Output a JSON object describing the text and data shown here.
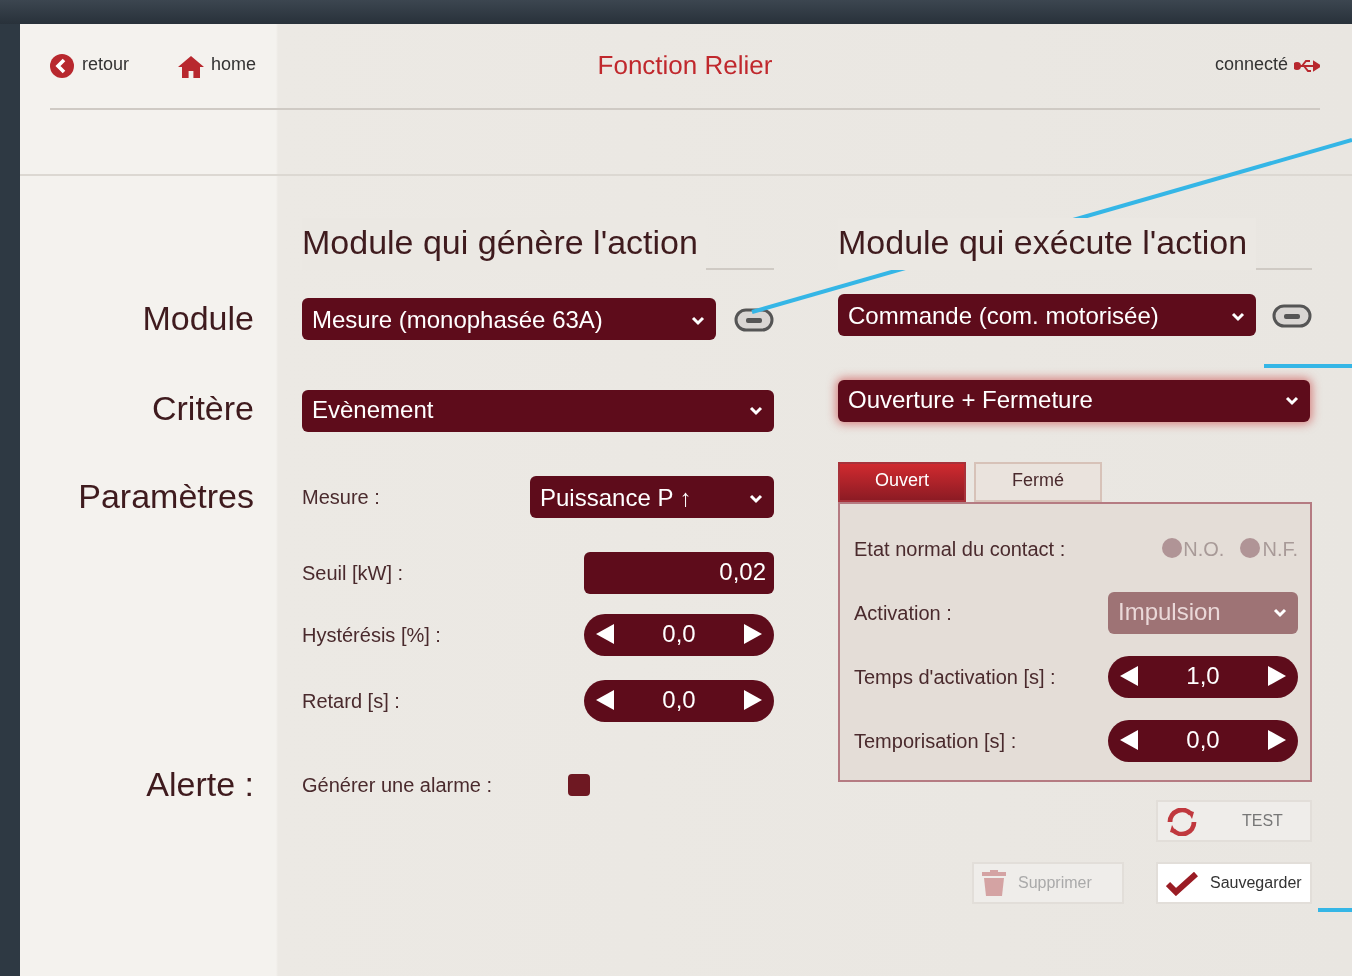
{
  "header": {
    "back": "retour",
    "home": "home",
    "title": "Fonction Relier",
    "status": "connecté"
  },
  "row_labels": [
    "Module",
    "Critère",
    "Paramètres",
    "Alerte :"
  ],
  "generator": {
    "heading": "Module qui génère l'action",
    "module": "Mesure (monophasée 63A)",
    "criterion": "Evènement",
    "params": [
      {
        "kind": "select",
        "label": "Mesure :",
        "value": "Puissance P ↑"
      },
      {
        "kind": "input",
        "label": "Seuil [kW]  :",
        "value": "0,02"
      },
      {
        "kind": "stepper",
        "label": "Hystérésis [%] :",
        "value": "0,0"
      },
      {
        "kind": "stepper",
        "label": "Retard [s] :",
        "value": "0,0"
      }
    ],
    "alert": {
      "label": "Générer une alarme :",
      "checked": true
    }
  },
  "executor": {
    "heading": "Module qui exécute l'action",
    "module": "Commande (com. motorisée)",
    "action": "Ouverture + Fermeture",
    "tabs": [
      {
        "label": "Ouvert",
        "selected": true
      },
      {
        "label": "Fermé",
        "selected": false
      }
    ],
    "fields": [
      {
        "kind": "radio",
        "label": "Etat normal du contact :",
        "disabled": true,
        "options": [
          {
            "label": "N.O.",
            "selected": false
          },
          {
            "label": "N.F.",
            "selected": false
          }
        ]
      },
      {
        "kind": "select",
        "label": "Activation :",
        "value": "Impulsion",
        "disabled": true
      },
      {
        "kind": "stepper",
        "label": "Temps d'activation  [s] :",
        "value": "1,0"
      },
      {
        "kind": "stepper",
        "label": "Temporisation [s] :",
        "value": "0,0"
      }
    ],
    "test": "TEST",
    "buttons": [
      {
        "kind": "delete",
        "label": "Supprimer",
        "disabled": true
      },
      {
        "kind": "save",
        "label": "Sauvegarder",
        "disabled": false
      }
    ]
  }
}
